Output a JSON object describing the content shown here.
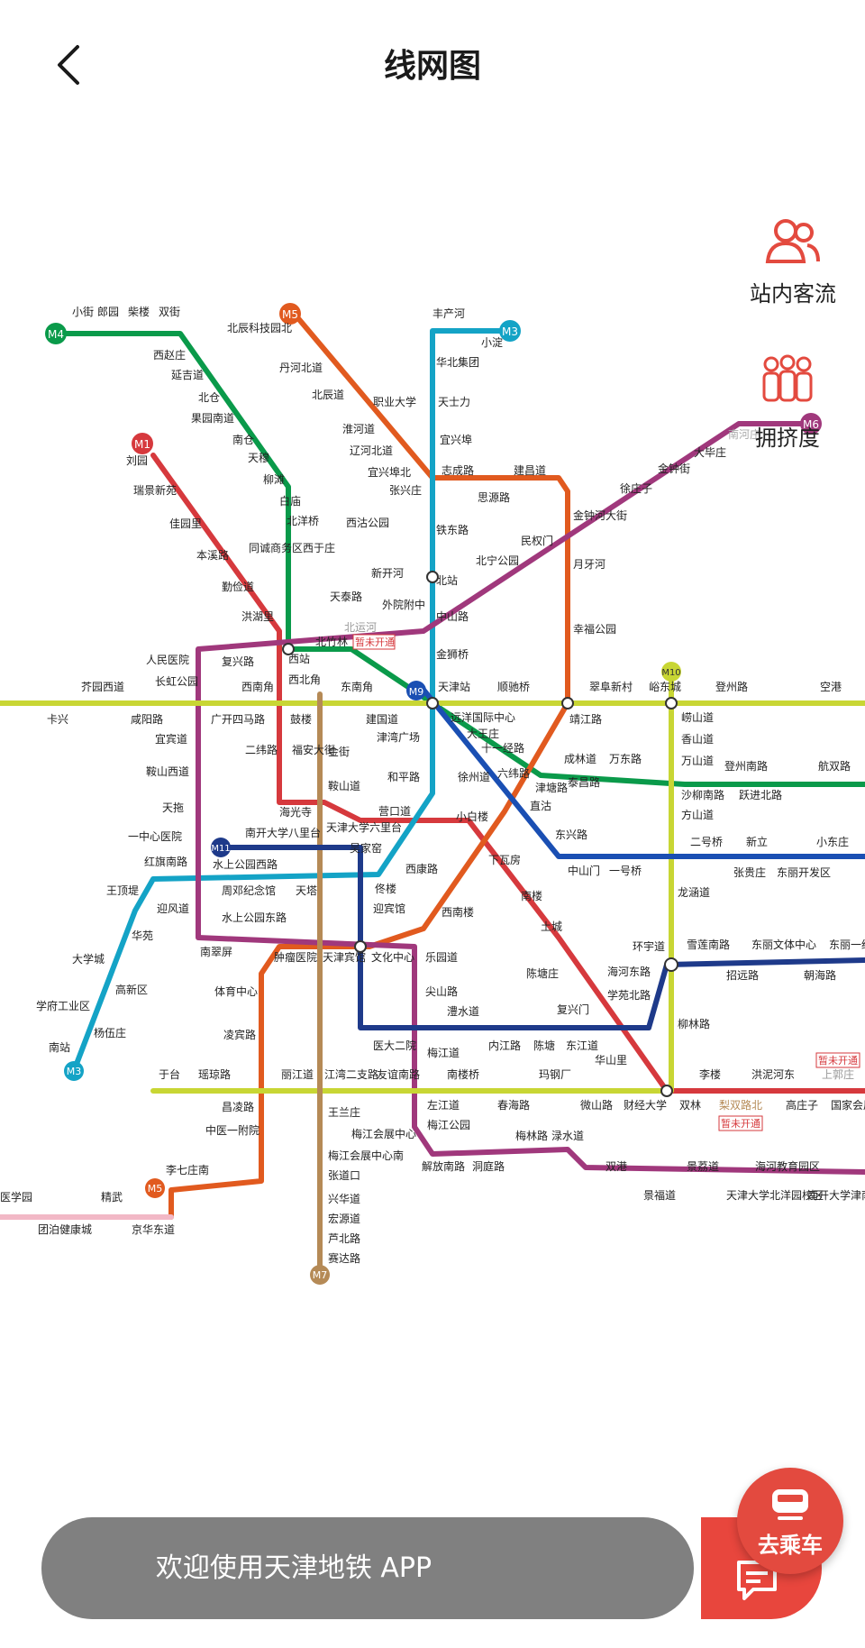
{
  "header": {
    "title": "线网图"
  },
  "side": {
    "flow_label": "站内客流",
    "crowd_label": "拥挤度"
  },
  "bottom": {
    "message": "欢迎使用天津地铁 APP",
    "ride_label": "去乘车"
  },
  "colors": {
    "M1": "#d6393d",
    "M2": "#c8d634",
    "M3": "#14a3c6",
    "M4": "#0a9a4a",
    "M5": "#e15a1f",
    "M6": "#a0387c",
    "M7": "#b58a56",
    "M9": "#1a4fb3",
    "M10": "#c8d634",
    "M11": "#1e3a8a",
    "accent": "#e34a3f"
  },
  "lines": [
    {
      "id": "M1",
      "badge": "M1"
    },
    {
      "id": "M3",
      "badge": "M3"
    },
    {
      "id": "M4",
      "badge": "M4"
    },
    {
      "id": "M5",
      "badge": "M5"
    },
    {
      "id": "M6",
      "badge": "M6"
    },
    {
      "id": "M7",
      "badge": "M7"
    },
    {
      "id": "M9",
      "badge": "M9"
    },
    {
      "id": "M10",
      "badge": "M10"
    },
    {
      "id": "M11",
      "badge": "M11"
    }
  ],
  "stations": [
    "小街",
    "郎园",
    "柴楼",
    "双街",
    "西赵庄",
    "延吉道",
    "北仓",
    "果园南道",
    "南仓",
    "天穆",
    "柳滩",
    "白庙",
    "北洋桥",
    "西沽公园",
    "刘园",
    "瑞景新苑",
    "佳园里",
    "本溪路",
    "勤俭道",
    "洪湖里",
    "西站",
    "复兴路",
    "人民医院",
    "长虹公园",
    "芥园西道",
    "卡兴",
    "咸阳路",
    "宜宾道",
    "鞍山西道",
    "天拖",
    "一中心医院",
    "红旗南路",
    "王顶堤",
    "华苑",
    "大学城",
    "高新区",
    "学府工业区",
    "杨伍庄",
    "南站",
    "北辰科技园北",
    "丹河北道",
    "北辰道",
    "职业大学",
    "淮河道",
    "辽河北道",
    "宜兴埠北",
    "张兴庄",
    "同诚商务区西于庄",
    "天泰路",
    "新开河",
    "外院附中",
    "北运河",
    "北竹林",
    "西北角",
    "西南角",
    "鼓楼",
    "广开四马路",
    "二纬路",
    "福安大街",
    "东南角",
    "金街",
    "鞍山道",
    "海光寺",
    "南开大学八里台",
    "天津大学六里台",
    "营口道",
    "吴家窑",
    "水上公园西路",
    "周邓纪念馆",
    "天塔",
    "迎风道",
    "水上公园东路",
    "南翠屏",
    "丰产河",
    "小淀",
    "华北集团",
    "天士力",
    "宜兴埠",
    "志成路",
    "思源路",
    "建昌道",
    "铁东路",
    "北宁公园",
    "民权门",
    "金钟河大街",
    "月牙河",
    "北站",
    "中山路",
    "金狮桥",
    "天津站",
    "顺驰桥",
    "幸福公园",
    "靖江路",
    "翠阜新村",
    "峪东城",
    "登州路",
    "空港",
    "建国道",
    "远洋国际中心",
    "大王庄",
    "十一经路",
    "成林道",
    "泰昌路",
    "津塘路",
    "直沽",
    "东兴路",
    "中山门",
    "一号桥",
    "二号桥",
    "新立",
    "小东庄",
    "张贵庄",
    "东丽开发区",
    "津湾广场",
    "和平路",
    "徐州道",
    "六纬路",
    "小白楼",
    "下瓦房",
    "西康路",
    "佟楼",
    "迎宾馆",
    "西南楼",
    "南楼",
    "土城",
    "陈塘庄",
    "复兴门",
    "华山里",
    "肿瘤医院",
    "天津宾馆",
    "文化中心",
    "乐园道",
    "尖山路",
    "澧水道",
    "体育中心",
    "凌宾路",
    "昌凌路",
    "中医一附院",
    "李七庄南",
    "于台",
    "瑶琼路",
    "丽江道",
    "江湾二支路",
    "友谊南路",
    "医大二院",
    "梅江道",
    "南楼桥",
    "内江路",
    "陈塘",
    "东江道",
    "玛钢厂",
    "王兰庄",
    "梅江会展中心",
    "梅江会展中心南",
    "张道口",
    "兴华道",
    "宏源道",
    "芦北路",
    "赛达路",
    "左江道",
    "梅江公园",
    "春海路",
    "解放南路",
    "洞庭路",
    "梅林路",
    "渌水道",
    "微山路",
    "财经大学",
    "双林",
    "梨双路北",
    "李楼",
    "洪泥河东",
    "上郭庄",
    "高庄子",
    "国家会展",
    "双港",
    "景荔道",
    "景福道",
    "天津大学北洋园校区",
    "海河教育园区",
    "南开大学津南校区",
    "环宇道",
    "海河东路",
    "学苑北路",
    "雪莲南路",
    "东丽文体中心",
    "东丽一经路",
    "招远路",
    "朝海路",
    "柳林路",
    "龙涵道",
    "崂山道",
    "香山道",
    "万山道",
    "登州南路",
    "航双路",
    "沙柳南路",
    "跃进北路",
    "方山道",
    "医学园",
    "精武",
    "团泊健康城",
    "京华东道",
    "大毕庄",
    "金钟街",
    "徐庄子",
    "南河庄",
    "万东路"
  ],
  "tags": {
    "not_open": "暂未开通"
  }
}
